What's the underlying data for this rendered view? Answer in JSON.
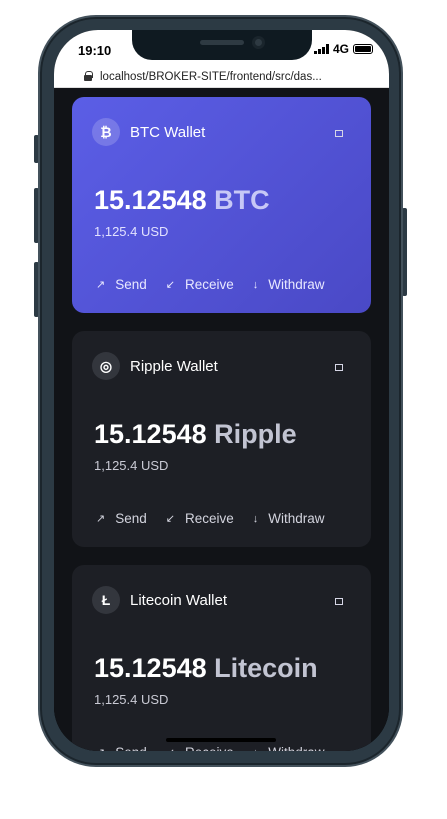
{
  "status": {
    "time": "19:10",
    "network": "4G"
  },
  "browser": {
    "url": "localhost/BROKER-SITE/frontend/src/das..."
  },
  "wallets": [
    {
      "icon_glyph": "₿",
      "icon_name": "bitcoin-icon",
      "name": "BTC Wallet",
      "amount": "15.12548",
      "unit": "BTC",
      "usd": "1,125.4 USD"
    },
    {
      "icon_glyph": "◎",
      "icon_name": "ripple-icon",
      "name": "Ripple Wallet",
      "amount": "15.12548",
      "unit": "Ripple",
      "usd": "1,125.4 USD"
    },
    {
      "icon_glyph": "Ł",
      "icon_name": "litecoin-icon",
      "name": "Litecoin Wallet",
      "amount": "15.12548",
      "unit": "Litecoin",
      "usd": "1,125.4 USD"
    }
  ],
  "actions": {
    "send": "Send",
    "receive": "Receive",
    "withdraw": "Withdraw"
  },
  "colors": {
    "accent": "#5b5ee6",
    "card_bg": "#1d1f25",
    "page_bg": "#111317",
    "frame": "#2c3a44"
  }
}
